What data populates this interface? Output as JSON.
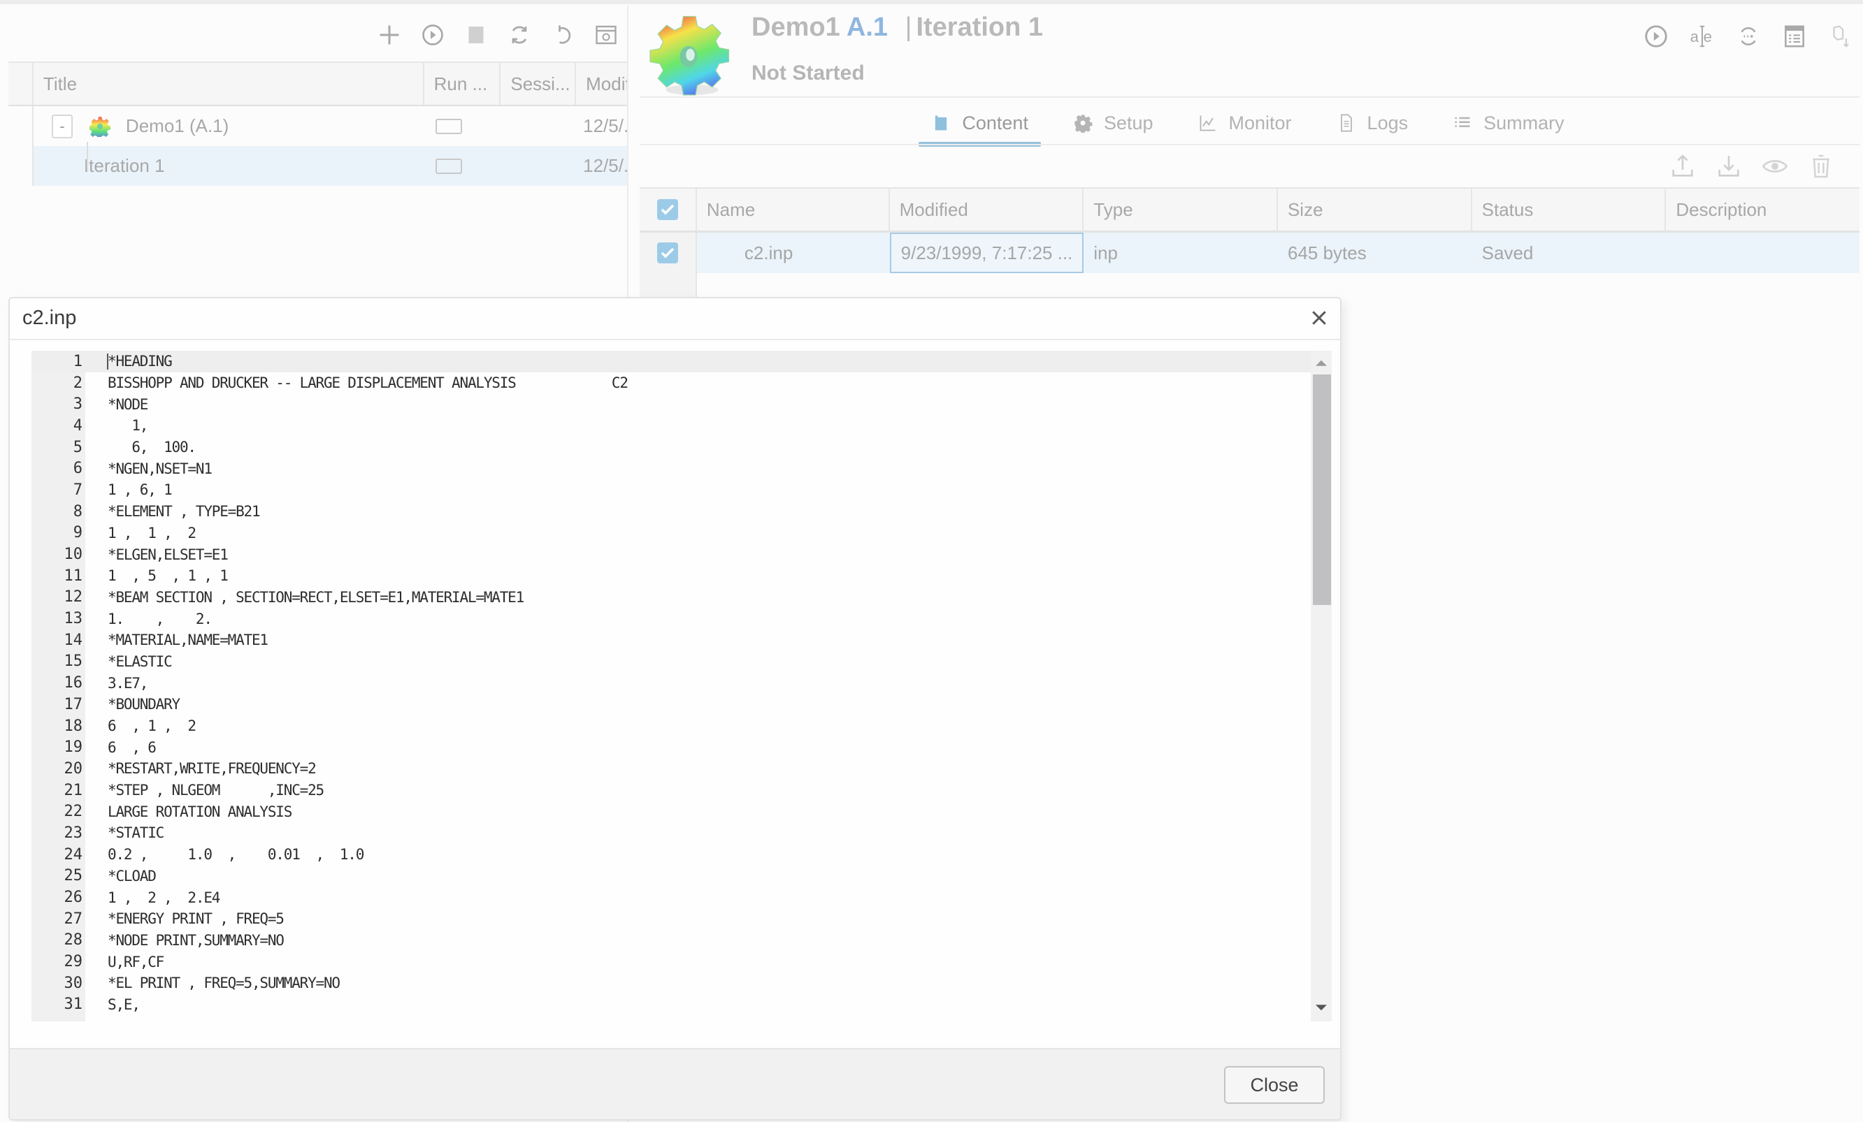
{
  "left_panel": {
    "toolbar": [
      {
        "name": "add-icon",
        "label": "Add"
      },
      {
        "name": "play-icon",
        "label": "Run"
      },
      {
        "name": "stop-icon",
        "label": "Stop"
      },
      {
        "name": "refresh-icon",
        "label": "Refresh"
      },
      {
        "name": "undo-icon",
        "label": "Reset"
      },
      {
        "name": "preview-icon",
        "label": "View"
      }
    ],
    "columns": [
      "Title",
      "Run ...",
      "Sessi...",
      "Modif"
    ],
    "rows": [
      {
        "title": "Demo1 (A.1)",
        "expand_label": "-",
        "icon": "gear-icon",
        "modified": "12/5/.",
        "selected": false
      },
      {
        "title": "Iteration 1",
        "modified": "12/5/.",
        "selected": true
      }
    ]
  },
  "header": {
    "project": "Demo1",
    "version": "A.1",
    "separator": "|",
    "iteration": "Iteration 1",
    "status": "Not Started",
    "actions": [
      "play-circle-icon",
      "text-edit-icon",
      "sync-icon",
      "table-icon",
      "export-icon"
    ]
  },
  "tabs": [
    {
      "label": "Content",
      "icon": "folder-icon",
      "active": true
    },
    {
      "label": "Setup",
      "icon": "gear-icon",
      "active": false
    },
    {
      "label": "Monitor",
      "icon": "line-chart-icon",
      "active": false
    },
    {
      "label": "Logs",
      "icon": "document-icon",
      "active": false
    },
    {
      "label": "Summary",
      "icon": "list-icon",
      "active": false
    }
  ],
  "file_actions": [
    "upload-icon",
    "download-icon",
    "view-icon",
    "trash-icon"
  ],
  "file_table": {
    "columns": [
      "Name",
      "Modified",
      "Type",
      "Size",
      "Status",
      "Description"
    ],
    "header_checked": true,
    "rows": [
      {
        "checked": true,
        "name": "c2.inp",
        "modified": "9/23/1999, 7:17:25 ...",
        "type": "inp",
        "size": "645 bytes",
        "status": "Saved",
        "description": ""
      }
    ]
  },
  "dialog": {
    "title": "c2.inp",
    "close_icon": "×",
    "close_button": "Close",
    "scroll_position": 0.0,
    "lines": [
      "*HEADING",
      "BISSHOPP AND DRUCKER -- LARGE DISPLACEMENT ANALYSIS            C2",
      "*NODE",
      "   1,",
      "   6,  100.",
      "*NGEN,NSET=N1",
      "1 , 6, 1",
      "*ELEMENT , TYPE=B21",
      "1 ,  1 ,  2",
      "*ELGEN,ELSET=E1",
      "1  , 5  , 1 , 1",
      "*BEAM SECTION , SECTION=RECT,ELSET=E1,MATERIAL=MATE1",
      "1.    ,    2.",
      "*MATERIAL,NAME=MATE1",
      "*ELASTIC",
      "3.E7,",
      "*BOUNDARY",
      "6  , 1 ,  2",
      "6  , 6",
      "*RESTART,WRITE,FREQUENCY=2",
      "*STEP , NLGEOM      ,INC=25",
      "LARGE ROTATION ANALYSIS",
      "*STATIC",
      "0.2 ,     1.0  ,    0.01  ,  1.0",
      "*CLOAD",
      "1 ,  2 ,  2.E4",
      "*ENERGY PRINT , FREQ=5",
      "*NODE PRINT,SUMMARY=NO",
      "U,RF,CF",
      "*EL PRINT , FREQ=5,SUMMARY=NO",
      "S,E,"
    ]
  }
}
